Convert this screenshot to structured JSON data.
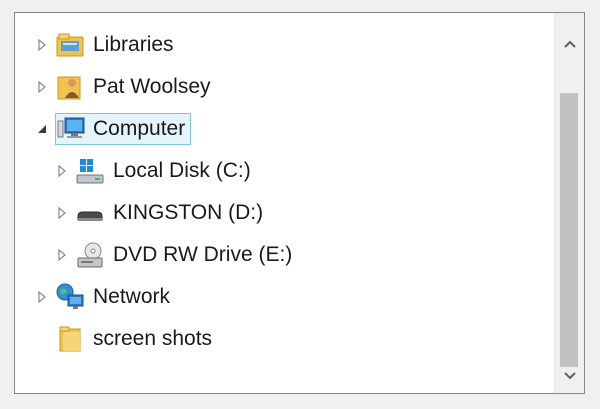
{
  "tree": {
    "items": [
      {
        "label": "Libraries",
        "icon": "libraries-folder-icon",
        "expander": "collapsed"
      },
      {
        "label": "Pat Woolsey",
        "icon": "user-folder-icon",
        "expander": "collapsed"
      },
      {
        "label": "Computer",
        "icon": "computer-icon",
        "expander": "expanded",
        "selected": true
      },
      {
        "label": "Local Disk (C:)",
        "icon": "windows-drive-icon",
        "expander": "collapsed"
      },
      {
        "label": "KINGSTON (D:)",
        "icon": "usb-drive-icon",
        "expander": "collapsed"
      },
      {
        "label": "DVD RW Drive (E:)",
        "icon": "dvd-drive-icon",
        "expander": "collapsed"
      },
      {
        "label": "Network",
        "icon": "network-icon",
        "expander": "collapsed"
      },
      {
        "label": "screen shots",
        "icon": "folder-icon",
        "expander": "none"
      }
    ]
  },
  "scrollbar": {
    "up": "scroll-up-icon",
    "down": "scroll-down-icon"
  },
  "colors": {
    "selection_bg": "#e5f3fb",
    "selection_border": "#7dc2e8",
    "folder": "#f1c34c"
  }
}
